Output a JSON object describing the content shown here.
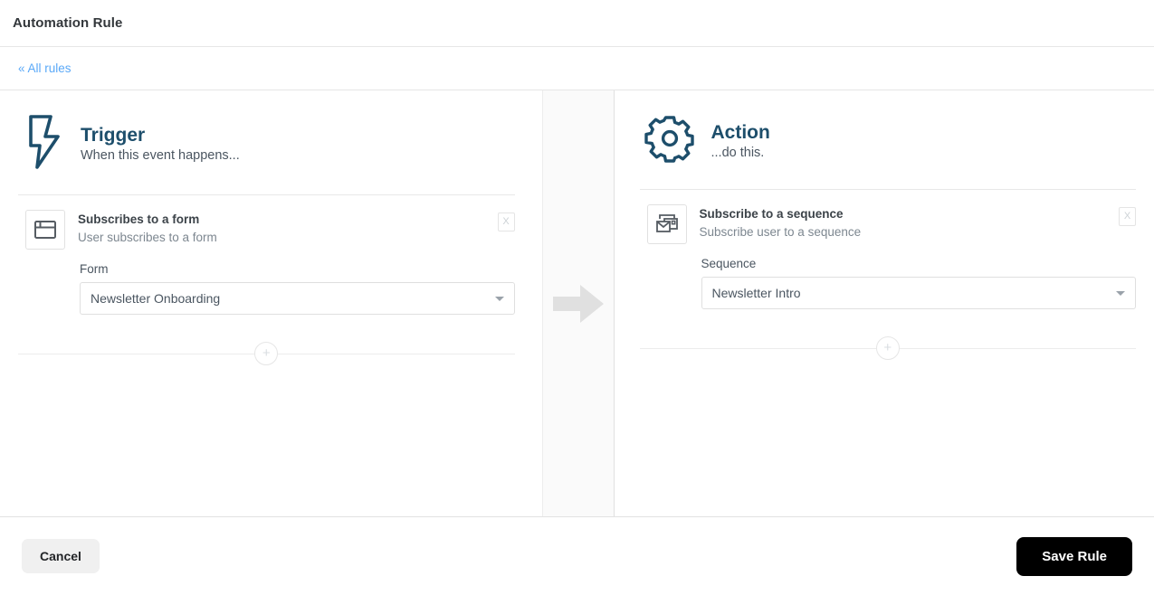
{
  "window": {
    "title": "Automation Rule"
  },
  "breadcrumb": {
    "back_label": "« All rules"
  },
  "flow": {
    "arrow_icon": "arrow-right-icon",
    "arrow_color": "#e0e0e0"
  },
  "trigger": {
    "icon": "lightning-bolt-icon",
    "title": "Trigger",
    "subtitle": "When this event happens...",
    "accent_color": "#1d4e6b",
    "card": {
      "icon": "browser-window-icon",
      "title": "Subscribes to a form",
      "subtitle": "User subscribes to a form",
      "remove_label": "X"
    },
    "field": {
      "label": "Form",
      "value": "Newsletter Onboarding",
      "caret_icon": "chevron-down-icon"
    },
    "add_label": "+"
  },
  "action": {
    "icon": "gear-icon",
    "title": "Action",
    "subtitle": "...do this.",
    "accent_color": "#1d4e6b",
    "card": {
      "icon": "envelope-sequence-icon",
      "title": "Subscribe to a sequence",
      "subtitle": "Subscribe user to a sequence",
      "remove_label": "X"
    },
    "field": {
      "label": "Sequence",
      "value": "Newsletter Intro",
      "caret_icon": "chevron-down-icon"
    },
    "add_label": "+"
  },
  "footer": {
    "cancel_label": "Cancel",
    "save_label": "Save Rule",
    "save_bg": "#000000"
  }
}
